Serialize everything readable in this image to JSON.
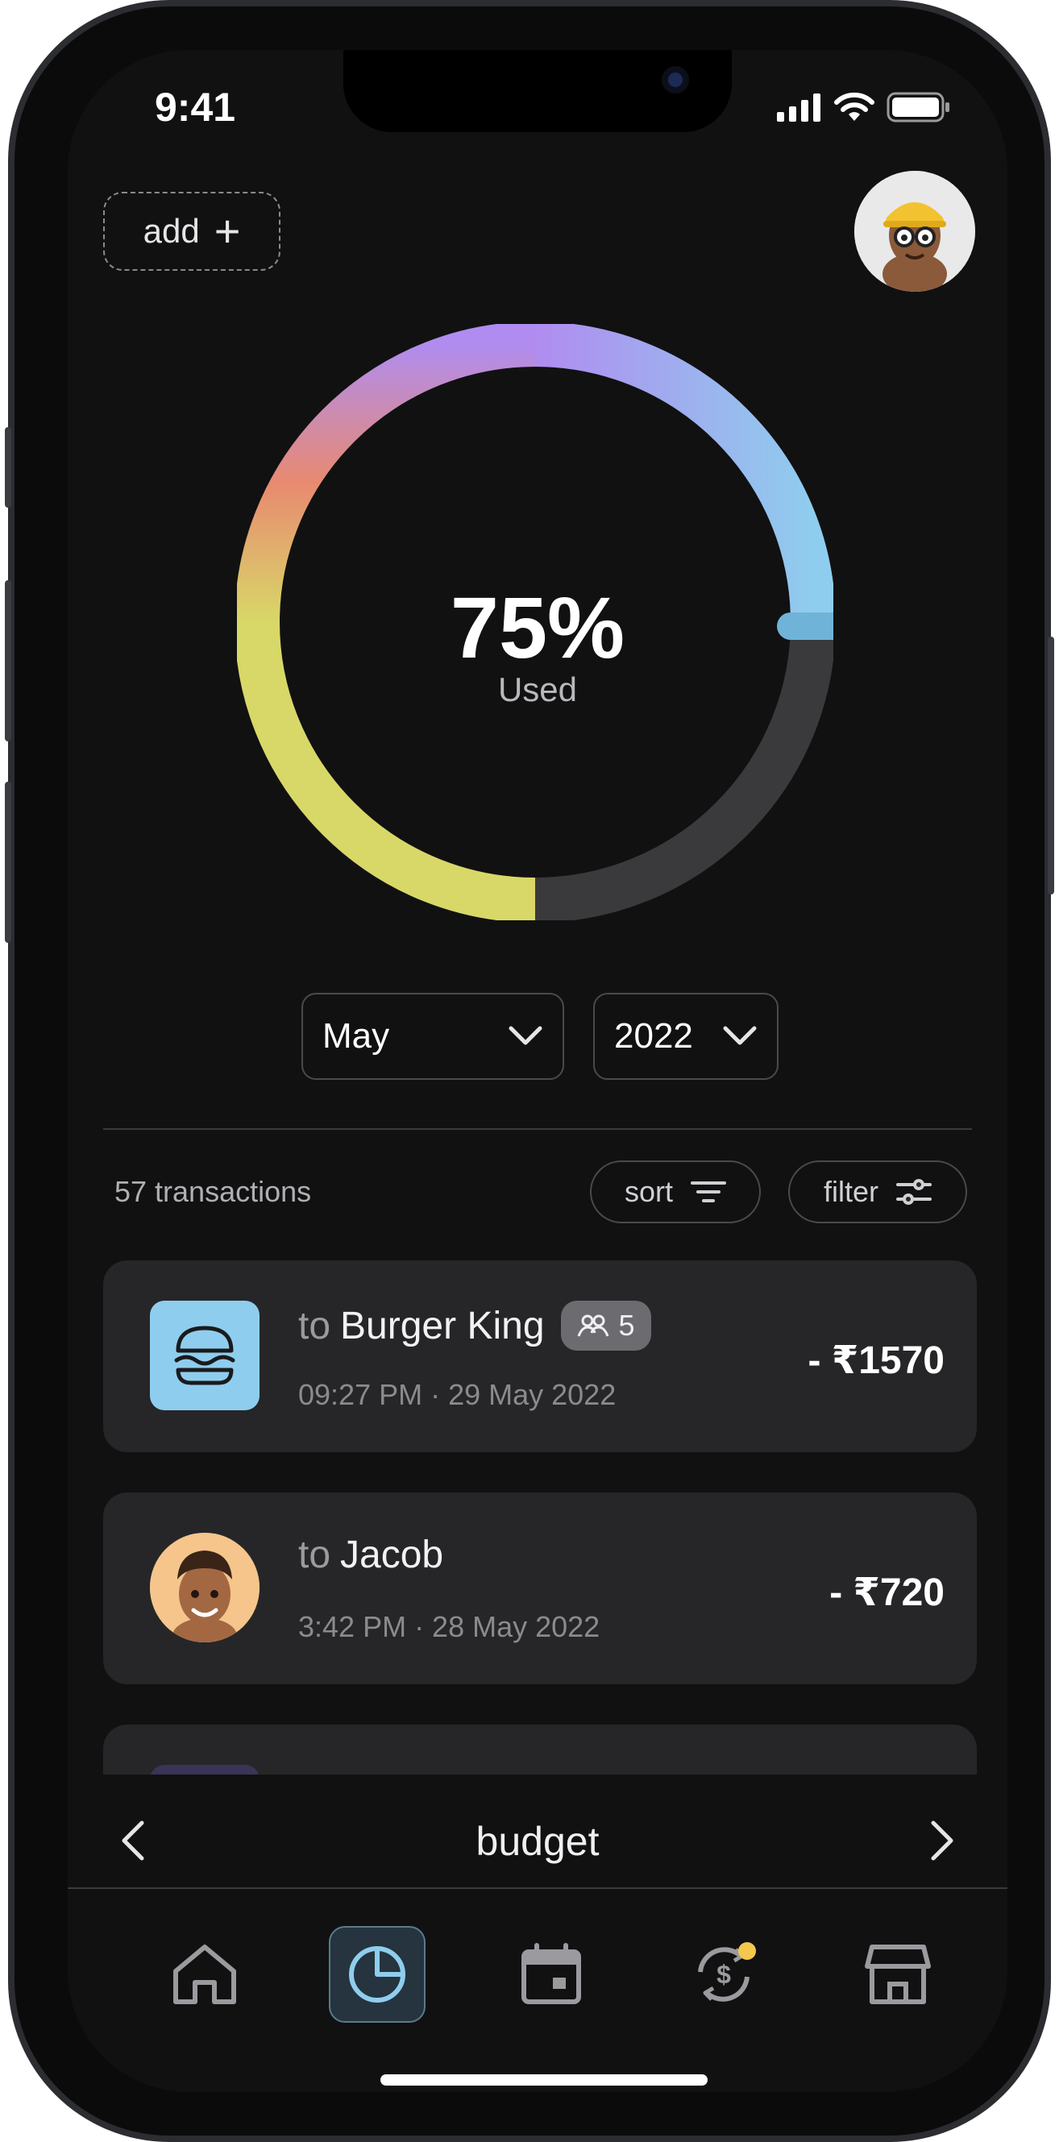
{
  "status_bar": {
    "time": "9:41"
  },
  "header": {
    "add_label": "add",
    "add_icon": "plus-icon"
  },
  "budget_ring": {
    "percent_label": "75%",
    "used_label": "Used",
    "used_fraction": 0.75
  },
  "filters": {
    "month": "May",
    "year": "2022"
  },
  "list": {
    "count_label": "57 transactions",
    "sort_label": "sort",
    "filter_label": "filter",
    "transactions": [
      {
        "prefix": "to",
        "name": "Burger King",
        "group_count": "5",
        "meta": "09:27 PM · 29 May 2022",
        "amount": "- ₹1570",
        "icon": "burger-icon"
      },
      {
        "prefix": "to",
        "name": "Jacob",
        "meta": "3:42 PM · 28 May 2022",
        "amount": "- ₹720",
        "icon": "avatar"
      }
    ]
  },
  "section_nav": {
    "title": "budget"
  },
  "tabs": [
    "home-icon",
    "pie-chart-icon",
    "calendar-icon",
    "exchange-icon",
    "store-icon"
  ],
  "colors": {
    "accent": "#8fcdee",
    "background": "#111112",
    "card": "#262628"
  }
}
